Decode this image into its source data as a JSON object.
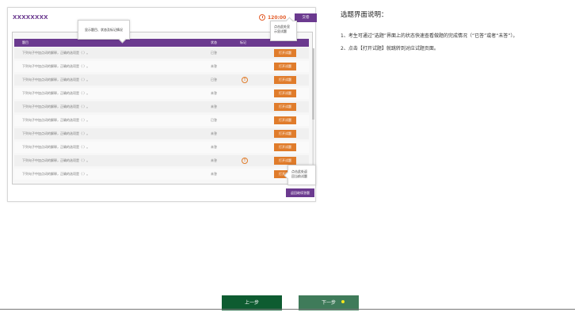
{
  "screen": {
    "brand": "XXXXXXXX",
    "timer": "120:00",
    "submit_label": "交卷",
    "tip_top": "显示题目、状态及标记情况",
    "tip_right_line1": "点击此处显",
    "tip_right_line2": "示显试题",
    "tip_bottom_line1": "点击此处返",
    "tip_bottom_line2": "回当前试题",
    "back_label": "返回继续答题",
    "headers": {
      "question": "题目",
      "status": "状态",
      "mark": "标记"
    },
    "rows": [
      {
        "question": "下列句子中加点词的解释，正确的选项是（ ）。",
        "status": "已答",
        "marked": false,
        "button": "打开试题"
      },
      {
        "question": "下列句子中加点词的解释，正确的选项是（ ）。",
        "status": "未答",
        "marked": false,
        "button": "打开试题"
      },
      {
        "question": "下列句子中加点词的解释，正确的选项是（ ）。",
        "status": "已答",
        "marked": true,
        "button": "打开试题"
      },
      {
        "question": "下列句子中加点词的解释，正确的选项是（ ）。",
        "status": "未答",
        "marked": false,
        "button": "打开试题"
      },
      {
        "question": "下列句子中加点词的解释，正确的选项是（ ）。",
        "status": "未答",
        "marked": false,
        "button": "打开试题"
      },
      {
        "question": "下列句子中加点词的解释，正确的选项是（ ）。",
        "status": "已答",
        "marked": false,
        "button": "打开试题"
      },
      {
        "question": "下列句子中加点词的解释，正确的选项是（ ）。",
        "status": "未答",
        "marked": false,
        "button": "打开试题"
      },
      {
        "question": "下列句子中加点词的解释，正确的选项是（ ）。",
        "status": "未答",
        "marked": false,
        "button": "打开试题"
      },
      {
        "question": "下列句子中加点词的解释，正确的选项是（ ）。",
        "status": "未答",
        "marked": true,
        "button": "打开试题"
      },
      {
        "question": "下列句子中加点词的解释，正确的选项是（ ）。",
        "status": "未答",
        "marked": false,
        "button": "打开试题"
      }
    ]
  },
  "instructions": {
    "title": "选题界面说明：",
    "items": [
      "1、考生可通过“选题”界面上的状态快速查看做题的完成情况（“已答”或者“未答”）。",
      "2、点击【打开试题】就跳转到对应试题页面。"
    ]
  },
  "nav": {
    "prev_label": "上一步",
    "next_label": "下一步"
  },
  "colors": {
    "purple": "#6b3a8f",
    "orange": "#e07c2b",
    "green_dark": "#0e5c31",
    "green": "#3f7b5a"
  }
}
